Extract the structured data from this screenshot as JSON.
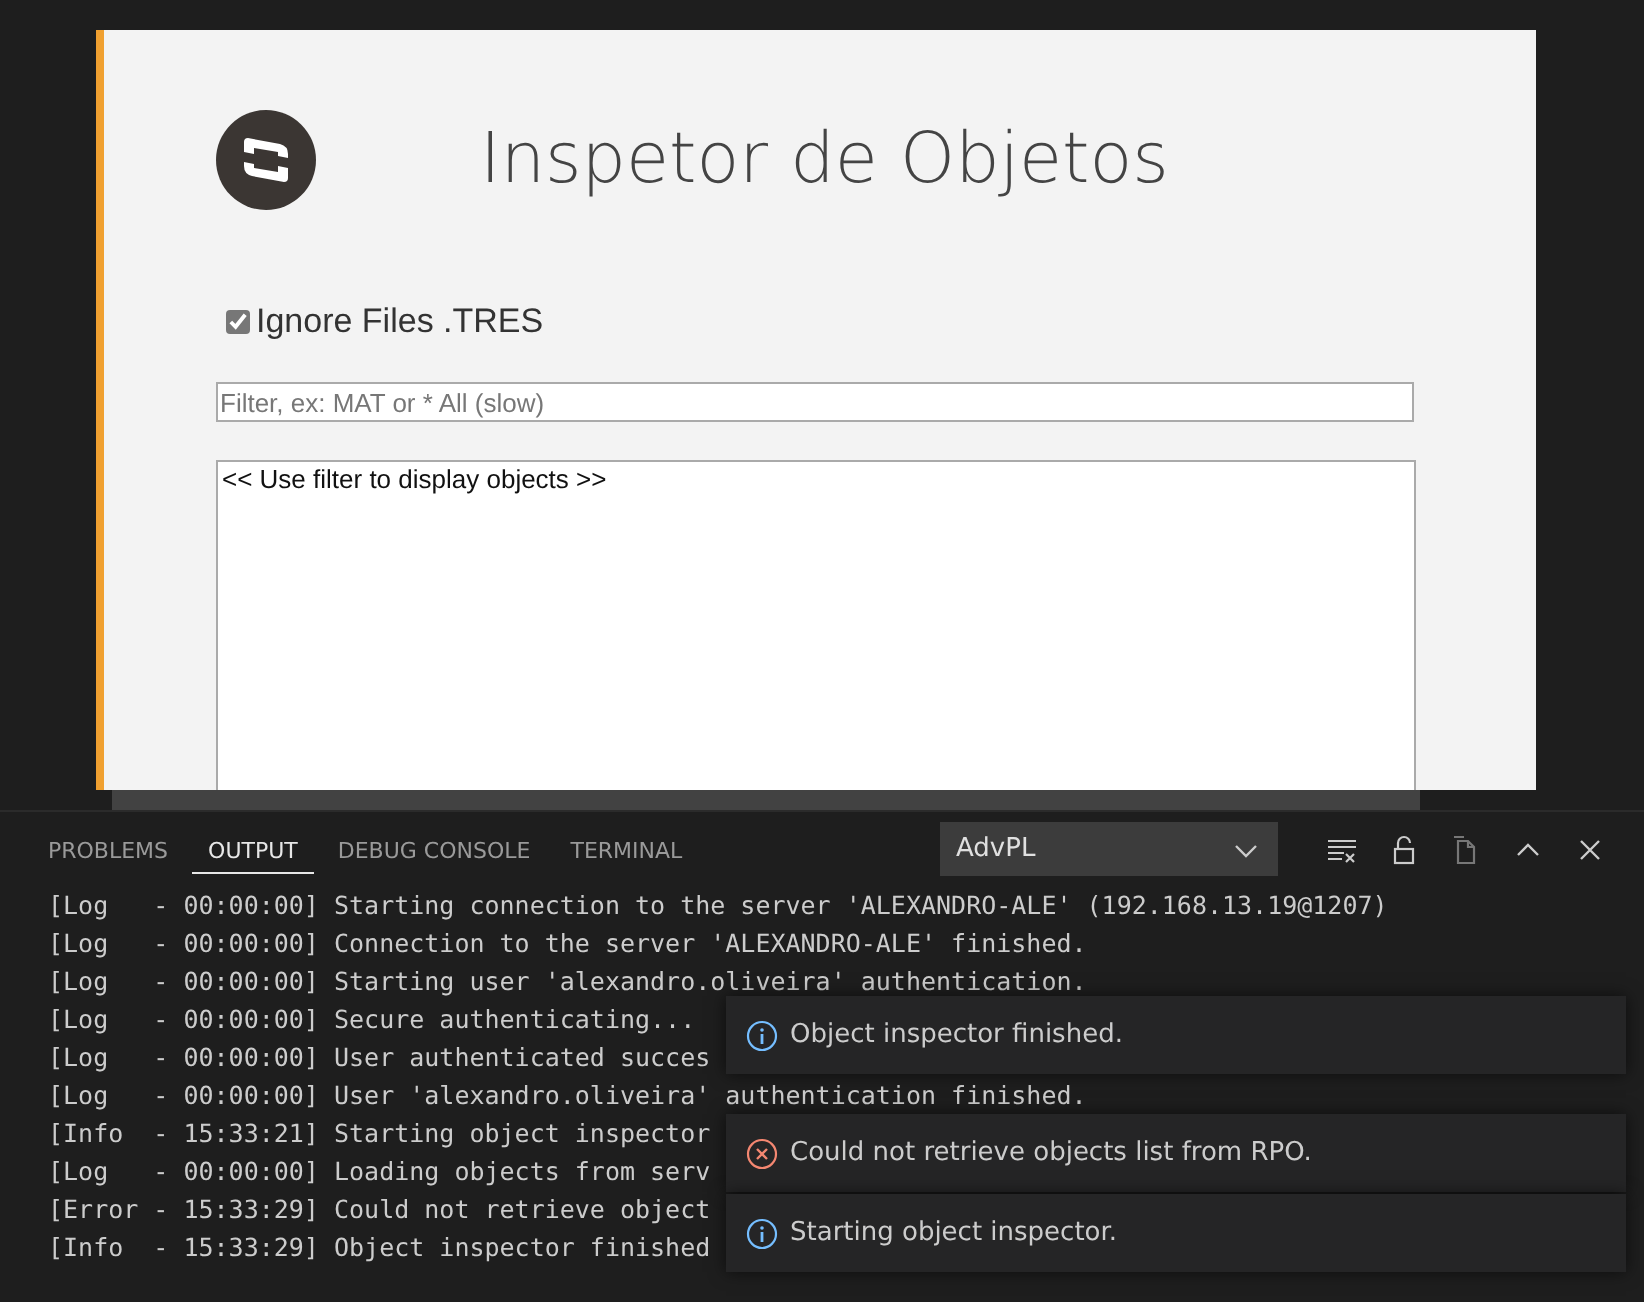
{
  "webview": {
    "title": "Inspetor de Objetos",
    "ignore_tres": {
      "label": "Ignore Files .TRES",
      "checked": true
    },
    "filter": {
      "placeholder": "Filter, ex: MAT or * All (slow)"
    },
    "objects_list": "<< Use filter to display objects >>"
  },
  "panel": {
    "tabs": [
      {
        "label": "PROBLEMS",
        "selected": false
      },
      {
        "label": "OUTPUT",
        "selected": true
      },
      {
        "label": "DEBUG CONSOLE",
        "selected": false
      },
      {
        "label": "TERMINAL",
        "selected": false
      }
    ],
    "channel": "AdvPL",
    "log": [
      "[Log   - 00:00:00] Starting connection to the server 'ALEXANDRO-ALE' (192.168.13.19@1207)",
      "[Log   - 00:00:00] Connection to the server 'ALEXANDRO-ALE' finished.",
      "[Log   - 00:00:00] Starting user 'alexandro.oliveira' authentication.",
      "[Log   - 00:00:00] Secure authenticating...",
      "[Log   - 00:00:00] User authenticated succes",
      "[Log   - 00:00:00] User 'alexandro.oliveira' authentication finished.",
      "[Info  - 15:33:21] Starting object inspector",
      "[Log   - 00:00:00] Loading objects from serv",
      "[Error - 15:33:29] Could not retrieve object",
      "[Info  - 15:33:29] Object inspector finished"
    ]
  },
  "notifications": [
    {
      "kind": "info",
      "message": "Object inspector finished."
    },
    {
      "kind": "error",
      "message": "Could not retrieve objects list from RPO."
    },
    {
      "kind": "info",
      "message": "Starting object inspector."
    }
  ]
}
